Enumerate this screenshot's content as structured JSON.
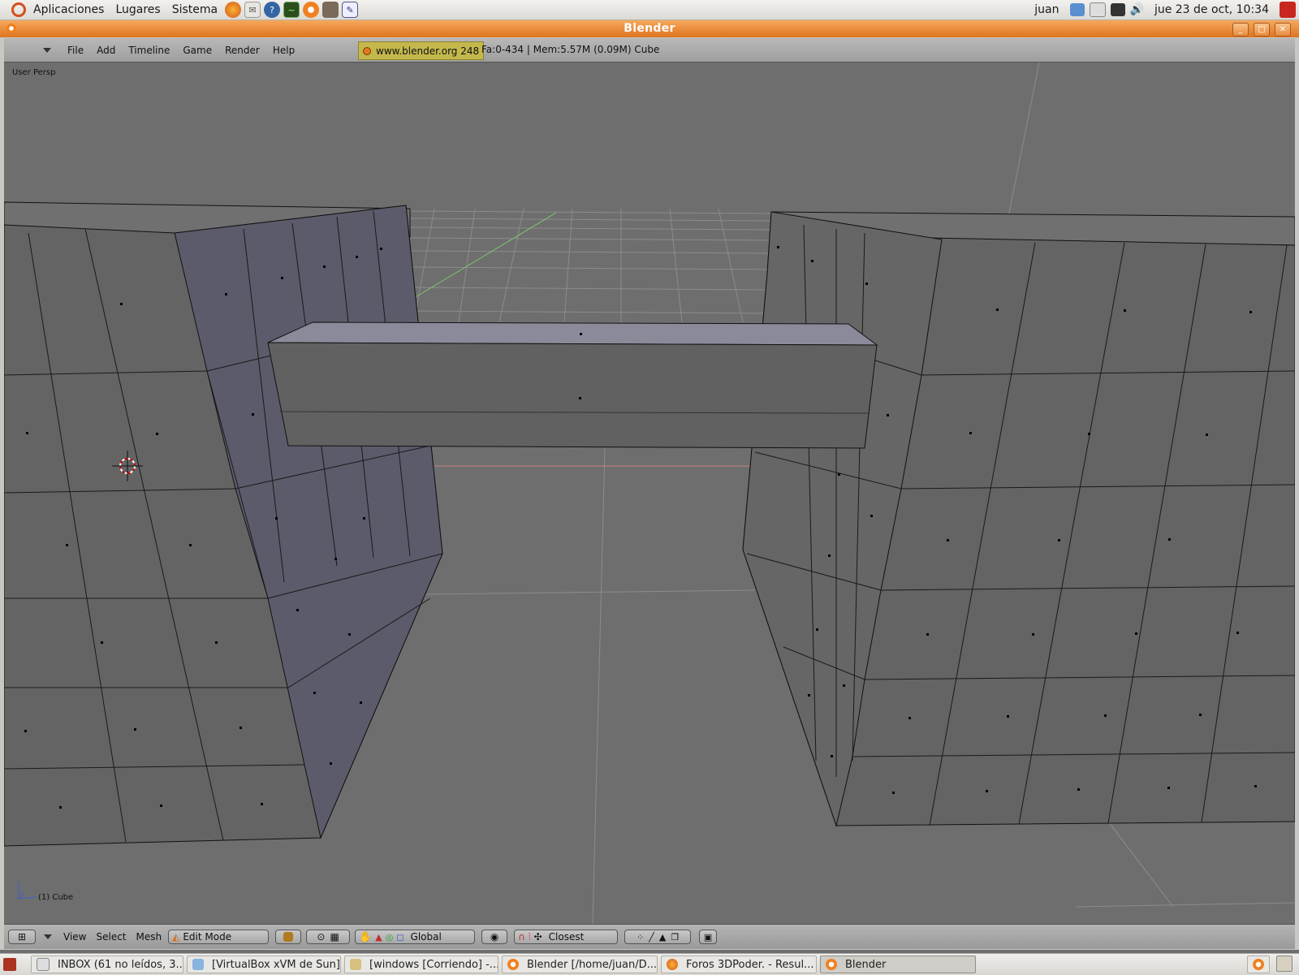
{
  "panel": {
    "menus": [
      "Aplicaciones",
      "Lugares",
      "Sistema"
    ],
    "user": "juan",
    "clock": "jue 23 de oct, 10:34"
  },
  "window": {
    "title": "Blender"
  },
  "blender_header": {
    "menus": [
      "File",
      "Add",
      "Timeline",
      "Game",
      "Render",
      "Help"
    ],
    "url": "www.blender.org 248",
    "info": "Fa:0-434 | Mem:5.57M (0.09M) Cube"
  },
  "viewport": {
    "view_label": "User Persp",
    "object_label": "(1) Cube"
  },
  "blender_footer": {
    "menus": [
      "View",
      "Select",
      "Mesh"
    ],
    "mode": "Edit Mode",
    "orientation": "Global",
    "snap": "Closest"
  },
  "taskbar": {
    "items": [
      "INBOX (61 no leídos, 3...",
      "[VirtualBox xVM de Sun]",
      "[windows [Corriendo] -...",
      "Blender [/home/juan/D...",
      "Foros 3DPoder. - Resul...",
      "Blender"
    ]
  },
  "colors": {
    "titlebar": "#de7420",
    "viewport_bg": "#6e6e6e",
    "mesh_face": "#6b6b6b",
    "mesh_side": "#5a5a6a",
    "url_box": "#c4b84c"
  }
}
